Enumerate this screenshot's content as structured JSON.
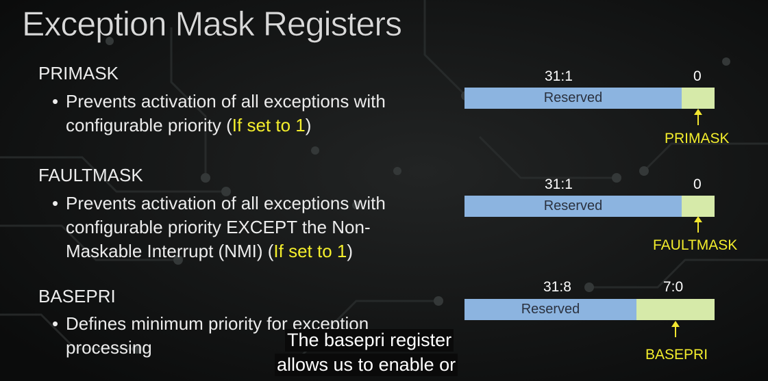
{
  "slide": {
    "title": "Exception Mask Registers",
    "sections": [
      {
        "heading": "PRIMASK",
        "bullet_lines": [
          "Prevents activation of all exceptions with",
          "configurable priority ("
        ],
        "highlight": "If set to 1",
        "bullet_end": ")",
        "bullet_dot": "•"
      },
      {
        "heading": "FAULTMASK",
        "bullet_lines": [
          "Prevents activation of all exceptions with",
          "configurable priority EXCEPT the Non-",
          "Maskable Interrupt (NMI) ("
        ],
        "highlight": "If set to 1",
        "bullet_end": ")",
        "bullet_dot": "•"
      },
      {
        "heading": "BASEPRI",
        "bullet_lines": [
          "Defines minimum priority for exception",
          "processing"
        ],
        "bullet_dot": "•"
      }
    ],
    "registers": [
      {
        "reserved_bits": "31:1",
        "field_bits": "0",
        "reserved_label": "Reserved",
        "field_name": "PRIMASK"
      },
      {
        "reserved_bits": "31:1",
        "field_bits": "0",
        "reserved_label": "Reserved",
        "field_name": "FAULTMASK"
      },
      {
        "reserved_bits": "31:8",
        "field_bits": "7:0",
        "reserved_label": "Reserved",
        "field_name": "BASEPRI"
      }
    ],
    "colors": {
      "reserved": "#8cb4e0",
      "field": "#d6eaa9",
      "highlight": "#f4ee2c"
    }
  },
  "subtitles": {
    "line1": "The basepri register",
    "line2": "allows us to enable or"
  }
}
